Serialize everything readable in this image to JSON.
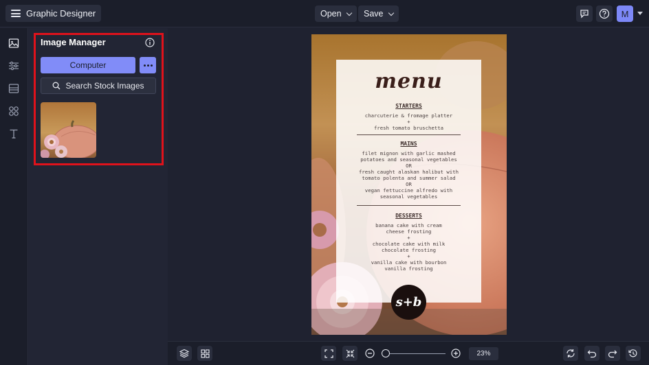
{
  "app": {
    "title": "Graphic Designer"
  },
  "header": {
    "open_label": "Open",
    "save_label": "Save",
    "avatar_initial": "M"
  },
  "panel": {
    "title": "Image Manager",
    "computer_label": "Computer",
    "stock_label": "Search Stock Images"
  },
  "design": {
    "title": "menu",
    "starters_heading": "STARTERS",
    "starters_text": "charcuterie & fromage platter\n+\nfresh tomato bruschetta",
    "mains_heading": "MAINS",
    "mains_text": "filet mignon with garlic mashed\npotatoes and seasonal vegetables\nOR\nfresh caught alaskan halibut with\ntomato polenta and summer salad\nOR\nvegan fettuccine alfredo with\nseasonal vegetables",
    "desserts_heading": "DESSERTS",
    "desserts_text": "banana cake with cream\ncheese frosting\n+\nchocolate cake with milk\nchocolate frosting\n+\nvanilla cake with bourbon\nvanilla frosting",
    "logo_text": "s+b"
  },
  "zoom": {
    "value": "23%",
    "fraction": 0.05
  },
  "colors": {
    "accent": "#818cf8",
    "highlight": "#e0121b",
    "background": "#1f2230"
  }
}
